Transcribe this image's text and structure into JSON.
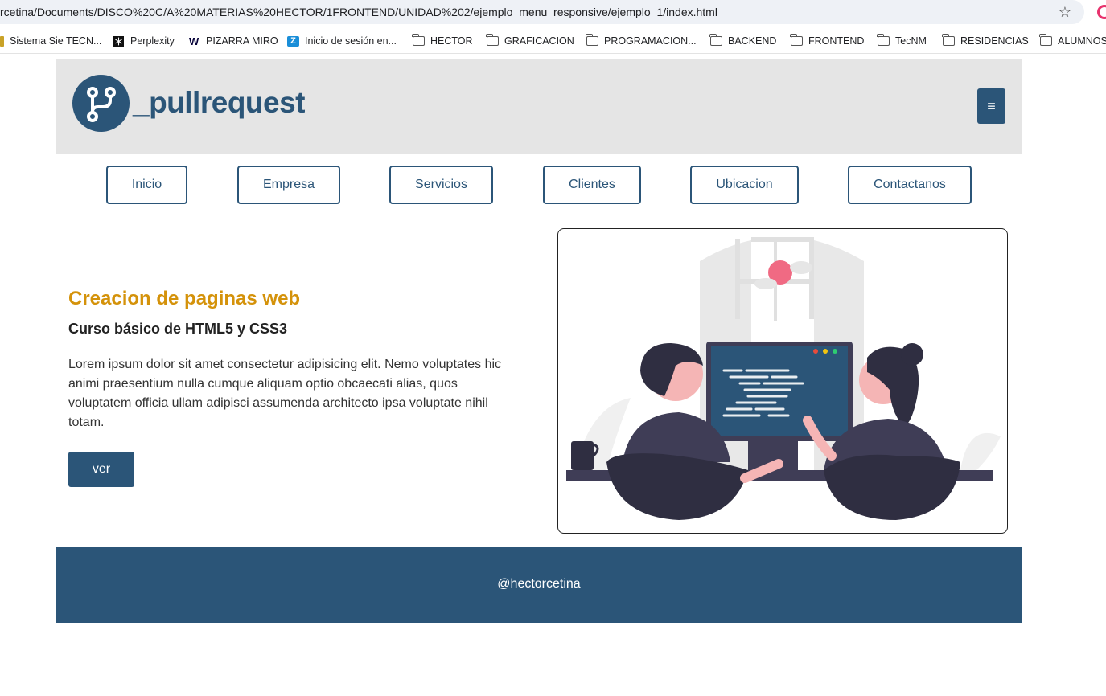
{
  "browser": {
    "url": "rcetina/Documents/DISCO%20C/A%20MATERIAS%20HECTOR/1FRONTEND/UNIDAD%202/ejemplo_menu_responsive/ejemplo_1/index.html",
    "bookmarks": [
      {
        "label": "Sistema Sie TECN...",
        "icon": "site-icon"
      },
      {
        "label": "Perplexity",
        "icon": "perplexity-icon"
      },
      {
        "label": "PIZARRA MIRO",
        "icon": "miro-icon"
      },
      {
        "label": "Inicio de sesión en...",
        "icon": "zoom-icon"
      },
      {
        "label": "HECTOR",
        "icon": "folder-icon"
      },
      {
        "label": "GRAFICACION",
        "icon": "folder-icon"
      },
      {
        "label": "PROGRAMACION...",
        "icon": "folder-icon"
      },
      {
        "label": "BACKEND",
        "icon": "folder-icon"
      },
      {
        "label": "FRONTEND",
        "icon": "folder-icon"
      },
      {
        "label": "TecNM",
        "icon": "folder-icon"
      },
      {
        "label": "RESIDENCIAS",
        "icon": "folder-icon"
      },
      {
        "label": "ALUMNOS",
        "icon": "folder-icon"
      }
    ]
  },
  "header": {
    "logo_text": "_pullrequest",
    "menu_icon": "≡"
  },
  "nav": {
    "items": [
      {
        "label": "Inicio"
      },
      {
        "label": "Empresa"
      },
      {
        "label": "Servicios"
      },
      {
        "label": "Clientes"
      },
      {
        "label": "Ubicacion"
      },
      {
        "label": "Contactanos"
      }
    ]
  },
  "hero": {
    "title": "Creacion de paginas web",
    "subtitle": "Curso básico de HTML5 y CSS3",
    "text": "Lorem ipsum dolor sit amet consectetur adipisicing elit. Nemo voluptates hic animi praesentium nulla cumque aliquam optio obcaecati alias, quos voluptatem officia ullam adipisci assumenda architecto ipsa voluptate nihil totam.",
    "button": "ver"
  },
  "footer": {
    "text": "@hectorcetina"
  },
  "colors": {
    "primary": "#2b5578",
    "accent": "#d4920a",
    "header_bg": "#e5e5e5"
  }
}
